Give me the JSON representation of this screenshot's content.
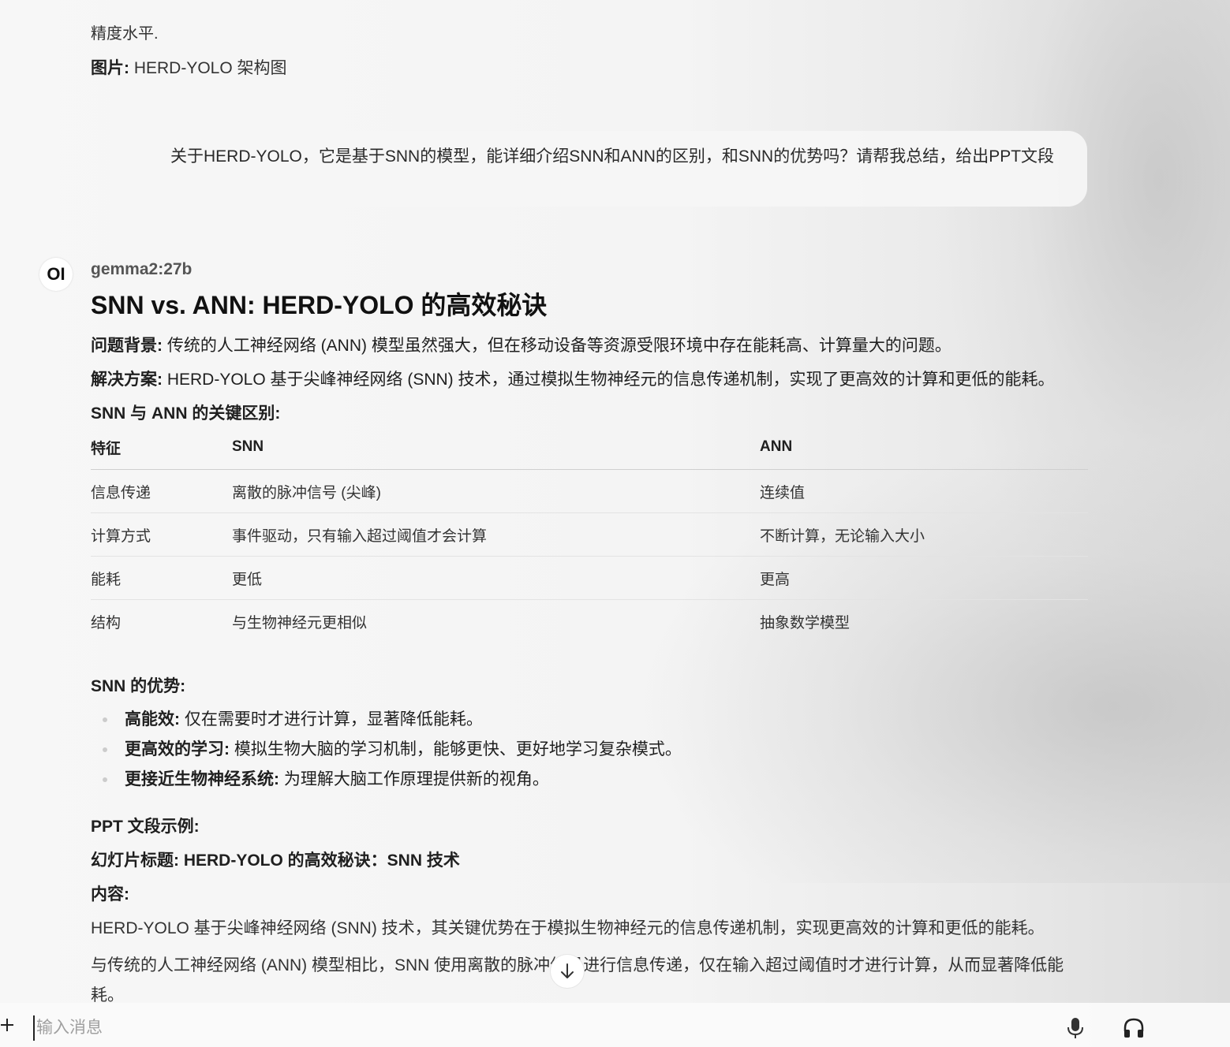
{
  "prev_message": {
    "tail": "精度水平.",
    "image_label": "图片:",
    "image_value": " HERD-YOLO 架构图"
  },
  "user_message": "关于HERD-YOLO，它是基于SNN的模型，能详细介绍SNN和ANN的区别，和SNN的优势吗？请帮我总结，给出PPT文段",
  "assistant": {
    "avatar_text": "OI",
    "model": "gemma2:27b",
    "heading": "SNN vs. ANN: HERD-YOLO 的高效秘诀",
    "background_label": "问题背景:",
    "background_text": " 传统的人工神经网络 (ANN) 模型虽然强大，但在移动设备等资源受限环境中存在能耗高、计算量大的问题。",
    "solution_label": "解决方案:",
    "solution_text": " HERD-YOLO 基于尖峰神经网络 (SNN) 技术，通过模拟生物神经元的信息传递机制，实现了更高效的计算和更低的能耗。",
    "diff_title": "SNN 与 ANN 的关键区别:",
    "table": {
      "headers": [
        "特征",
        "SNN",
        "ANN"
      ],
      "rows": [
        [
          "信息传递",
          "离散的脉冲信号 (尖峰)",
          "连续值"
        ],
        [
          "计算方式",
          "事件驱动，只有输入超过阈值才会计算",
          "不断计算，无论输入大小"
        ],
        [
          "能耗",
          "更低",
          "更高"
        ],
        [
          "结构",
          "与生物神经元更相似",
          "抽象数学模型"
        ]
      ]
    },
    "advantages_title": "SNN 的优势:",
    "advantages": [
      {
        "label": "高能效:",
        "text": " 仅在需要时才进行计算，显著降低能耗。"
      },
      {
        "label": "更高效的学习:",
        "text": " 模拟生物大脑的学习机制，能够更快、更好地学习复杂模式。"
      },
      {
        "label": "更接近生物神经系统:",
        "text": " 为理解大脑工作原理提供新的视角。"
      }
    ],
    "ppt_title": "PPT 文段示例:",
    "slide_title": "幻灯片标题: HERD-YOLO 的高效秘诀：SNN 技术",
    "content_label": "内容:",
    "content_p1": "HERD-YOLO 基于尖峰神经网络 (SNN) 技术，其关键优势在于模拟生物神经元的信息传递机制，实现更高效的计算和更低的能耗。",
    "content_p2": "与传统的人工神经网络 (ANN) 模型相比，SNN 使用离散的脉冲信号进行信息传递，仅在输入超过阈值时才进行计算，从而显著降低能耗。"
  },
  "input": {
    "placeholder": "输入消息",
    "value": ""
  },
  "icons": {
    "plus": "plus-icon",
    "mic": "microphone-icon",
    "headphones": "headphones-icon",
    "scroll": "arrow-down-icon"
  }
}
